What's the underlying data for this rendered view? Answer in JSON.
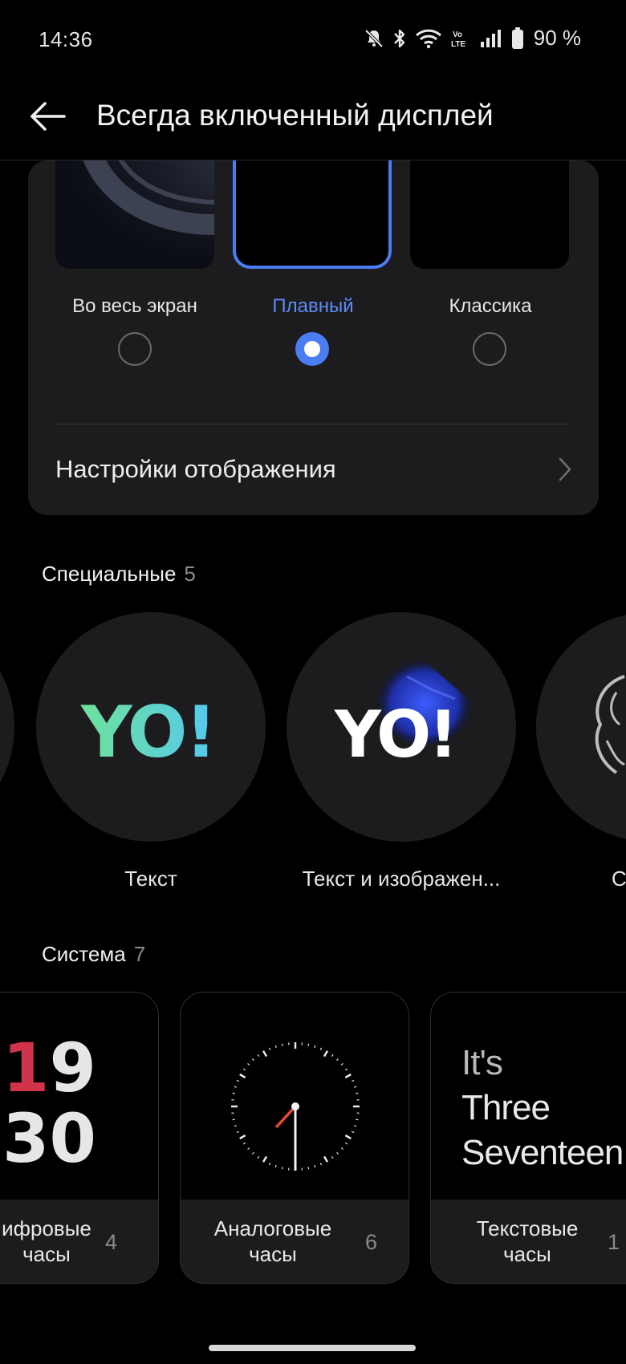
{
  "status_bar": {
    "time": "14:36",
    "battery_percent": "90 %",
    "icons": [
      "mute-icon",
      "bluetooth-icon",
      "wifi-icon",
      "volte-icon",
      "signal-icon",
      "battery-icon"
    ]
  },
  "header": {
    "title": "Всегда включенный дисплей",
    "back_icon": "back-arrow-icon"
  },
  "style_options": [
    {
      "label": "Во весь экран",
      "selected": false
    },
    {
      "label": "Плавный",
      "selected": true
    },
    {
      "label": "Классика",
      "selected": false
    }
  ],
  "display_settings": {
    "label": "Настройки отображения",
    "icon": "chevron-right-icon"
  },
  "special": {
    "title": "Специальные",
    "count": "5",
    "items": [
      {
        "label": "Текст",
        "art_text": "YO!"
      },
      {
        "label": "Текст и изображен...",
        "art_text": "YO!"
      },
      {
        "label": "С"
      }
    ]
  },
  "system": {
    "title": "Система",
    "count": "7",
    "items": [
      {
        "label_line1": "ифровые",
        "label_line2": "часы",
        "count": "4",
        "preview_hours": "19",
        "preview_minutes": "30"
      },
      {
        "label_line1": "Аналоговые",
        "label_line2": "часы",
        "count": "6"
      },
      {
        "label_line1": "Текстовые",
        "label_line2": "часы",
        "count": "1",
        "preview_line1": "It's",
        "preview_line2": "Three",
        "preview_line3": "Seventeen"
      }
    ]
  },
  "colors": {
    "accent": "#4a7cf2",
    "card_bg": "#1c1c1e",
    "digital_hour_red": "#d0334a",
    "analog_minute_hand": "#e64a2e"
  }
}
